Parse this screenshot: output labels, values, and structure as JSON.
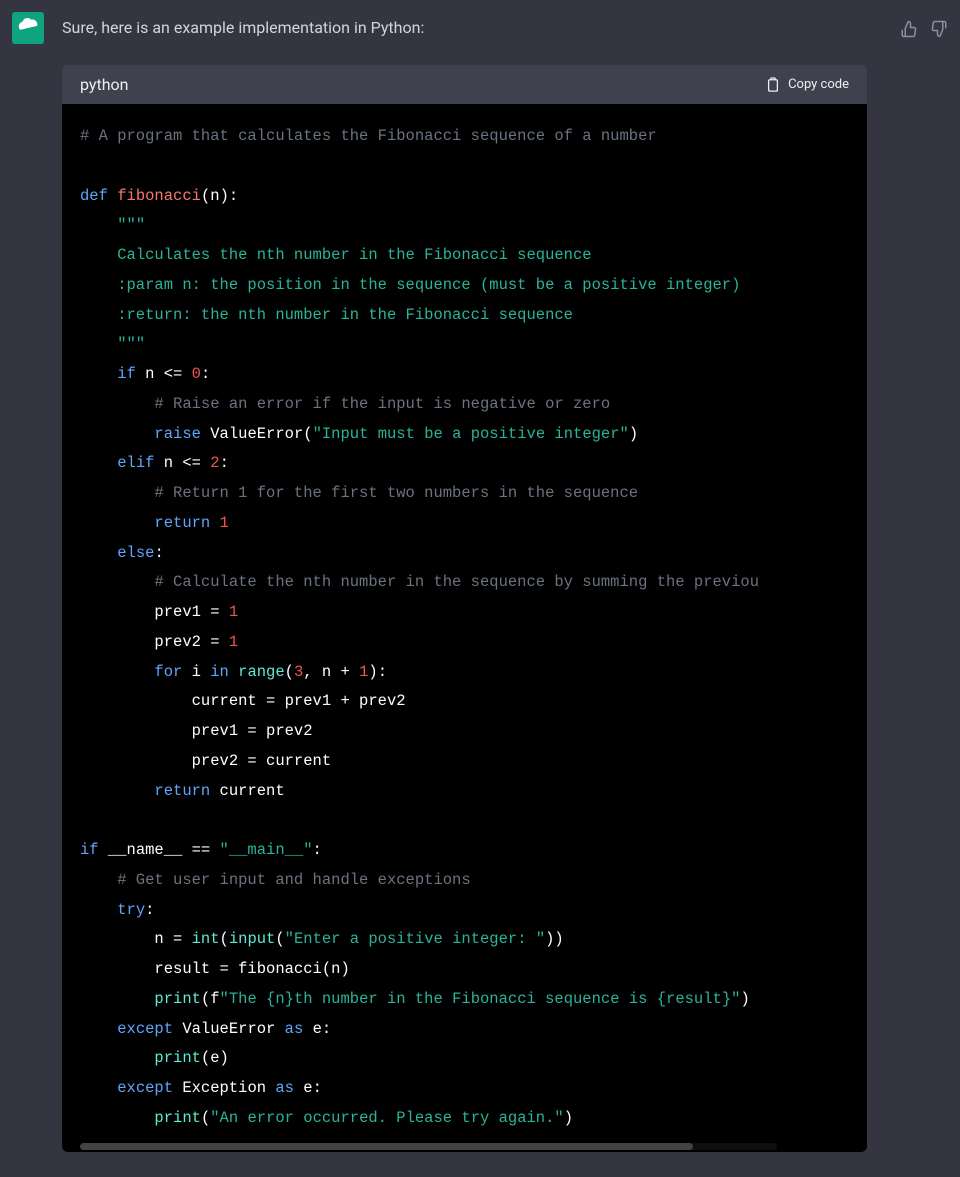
{
  "message": {
    "intro": "Sure, here is an example implementation in Python:"
  },
  "codeHeader": {
    "language": "python",
    "copyLabel": "Copy code"
  },
  "code": {
    "l1_comment": "# A program that calculates the Fibonacci sequence of a number",
    "l2_def": "def",
    "l2_name": "fibonacci",
    "l2_paren_open": "(",
    "l2_param": "n",
    "l2_paren_close": "):",
    "l3_docq": "\"\"\"",
    "l4_doc": "    Calculates the nth number in the Fibonacci sequence",
    "l5_doc": "    :param n: the position in the sequence (must be a positive integer)",
    "l6_doc": "    :return: the nth number in the Fibonacci sequence",
    "l7_docq": "    \"\"\"",
    "l8_if": "if",
    "l8_cond": " n <= ",
    "l8_zero": "0",
    "l8_colon": ":",
    "l9_comment": "        # Raise an error if the input is negative or zero",
    "l10_raise": "raise",
    "l10_class": "ValueError",
    "l10_p1": "(",
    "l10_str": "\"Input must be a positive integer\"",
    "l10_p2": ")",
    "l11_elif": "elif",
    "l11_cond": " n <= ",
    "l11_two": "2",
    "l11_colon": ":",
    "l12_comment": "        # Return 1 for the first two numbers in the sequence",
    "l13_return": "return",
    "l13_one": "1",
    "l14_else": "else",
    "l14_colon": ":",
    "l15_comment": "        # Calculate the nth number in the sequence by summing the previou",
    "l16_a": "        prev1 = ",
    "l16_one": "1",
    "l17_a": "        prev2 = ",
    "l17_one": "1",
    "l18_for": "for",
    "l18_i": " i ",
    "l18_in": "in",
    "l18_range": " range",
    "l18_p1": "(",
    "l18_three": "3",
    "l18_comma": ", n + ",
    "l18_one": "1",
    "l18_p2": "):",
    "l19": "            current = prev1 + prev2",
    "l20": "            prev1 = prev2",
    "l21": "            prev2 = current",
    "l22_return": "return",
    "l22_cur": " current",
    "l23_if": "if",
    "l23_name": " __name__ == ",
    "l23_main": "\"__main__\"",
    "l23_colon": ":",
    "l24_comment": "    # Get user input and handle exceptions",
    "l25_try": "try",
    "l25_colon": ":",
    "l26_a": "        n = ",
    "l26_int": "int",
    "l26_p1": "(",
    "l26_input": "input",
    "l26_p2": "(",
    "l26_str": "\"Enter a positive integer: \"",
    "l26_p3": "))",
    "l27": "        result = fibonacci(n)",
    "l28_print": "print",
    "l28_p1": "(f",
    "l28_str": "\"The {n}th number in the Fibonacci sequence is {result}\"",
    "l28_p2": ")",
    "l29_except": "except",
    "l29_class": " ValueError ",
    "l29_as": "as",
    "l29_e": " e:",
    "l30_print": "print",
    "l30_e": "(e)",
    "l31_except": "except",
    "l31_class": " Exception ",
    "l31_as": "as",
    "l31_e": " e:",
    "l32_print": "print",
    "l32_p1": "(",
    "l32_str": "\"An error occurred. Please try again.\"",
    "l32_p2": ")"
  }
}
